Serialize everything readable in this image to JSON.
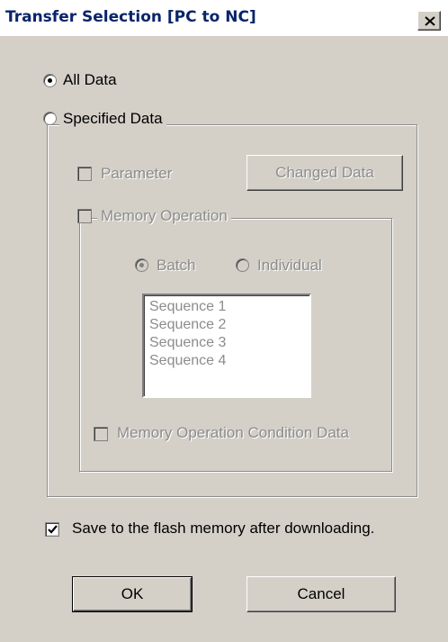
{
  "window": {
    "title": "Transfer Selection [PC to NC]",
    "close_glyph": "X"
  },
  "options": {
    "all_data": {
      "label": "All Data",
      "selected": true
    },
    "specified_data": {
      "label": "Specified Data",
      "selected": false
    }
  },
  "specified": {
    "parameter": {
      "label": "Parameter",
      "checked": false
    },
    "changed_data_button": "Changed Data",
    "memory_operation": {
      "label": "Memory Operation",
      "checked": false,
      "batch_label": "Batch",
      "individual_label": "Individual",
      "batch_selected": true,
      "sequences": [
        "Sequence 1",
        "Sequence 2",
        "Sequence 3",
        "Sequence 4"
      ],
      "condition_data": {
        "label": "Memory Operation Condition Data",
        "checked": false
      }
    }
  },
  "save_flash": {
    "label": "Save to the flash memory after downloading.",
    "checked": true
  },
  "buttons": {
    "ok": "OK",
    "cancel": "Cancel"
  }
}
